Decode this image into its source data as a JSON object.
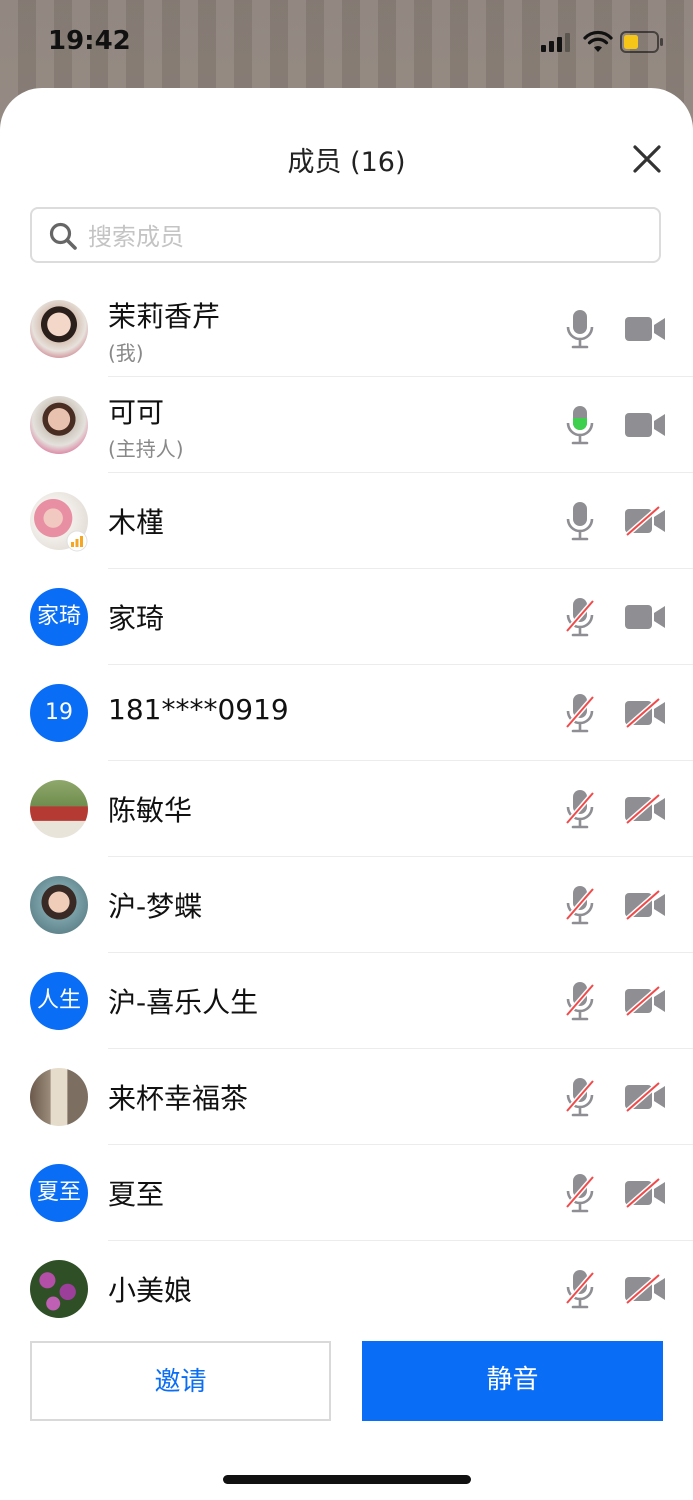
{
  "status_bar": {
    "time": "19:42"
  },
  "header": {
    "title": "成员 (16)"
  },
  "search": {
    "placeholder": "搜索成员",
    "value": ""
  },
  "members": [
    {
      "name": "茉莉香芹",
      "role": "(我)",
      "avatar_type": "photo",
      "mic": "on",
      "camera": "on"
    },
    {
      "name": "可可",
      "role": "(主持人)",
      "avatar_type": "photo",
      "mic": "speaking",
      "camera": "on"
    },
    {
      "name": "木槿",
      "role": "",
      "avatar_type": "photo",
      "mic": "on",
      "camera": "off"
    },
    {
      "name": "家琦",
      "role": "",
      "avatar_type": "text",
      "avatar_text": "家琦",
      "mic": "off",
      "camera": "on"
    },
    {
      "name": "181****0919",
      "role": "",
      "avatar_type": "text",
      "avatar_text": "19",
      "mic": "off",
      "camera": "off"
    },
    {
      "name": "陈敏华",
      "role": "",
      "avatar_type": "photo",
      "mic": "off",
      "camera": "off"
    },
    {
      "name": "沪-梦蝶",
      "role": "",
      "avatar_type": "photo",
      "mic": "off",
      "camera": "off"
    },
    {
      "name": "沪-喜乐人生",
      "role": "",
      "avatar_type": "text",
      "avatar_text": "人生",
      "mic": "off",
      "camera": "off"
    },
    {
      "name": "来杯幸福茶",
      "role": "",
      "avatar_type": "photo",
      "mic": "off",
      "camera": "off"
    },
    {
      "name": "夏至",
      "role": "",
      "avatar_type": "text",
      "avatar_text": "夏至",
      "mic": "off",
      "camera": "off"
    },
    {
      "name": "小美娘",
      "role": "",
      "avatar_type": "photo",
      "mic": "off",
      "camera": "off"
    }
  ],
  "buttons": {
    "invite": "邀请",
    "mute": "静音"
  },
  "colors": {
    "accent": "#0a6df5",
    "speaking": "#3ecf4f",
    "icon_gray": "#8e8e93",
    "strike": "#f04a4a"
  }
}
